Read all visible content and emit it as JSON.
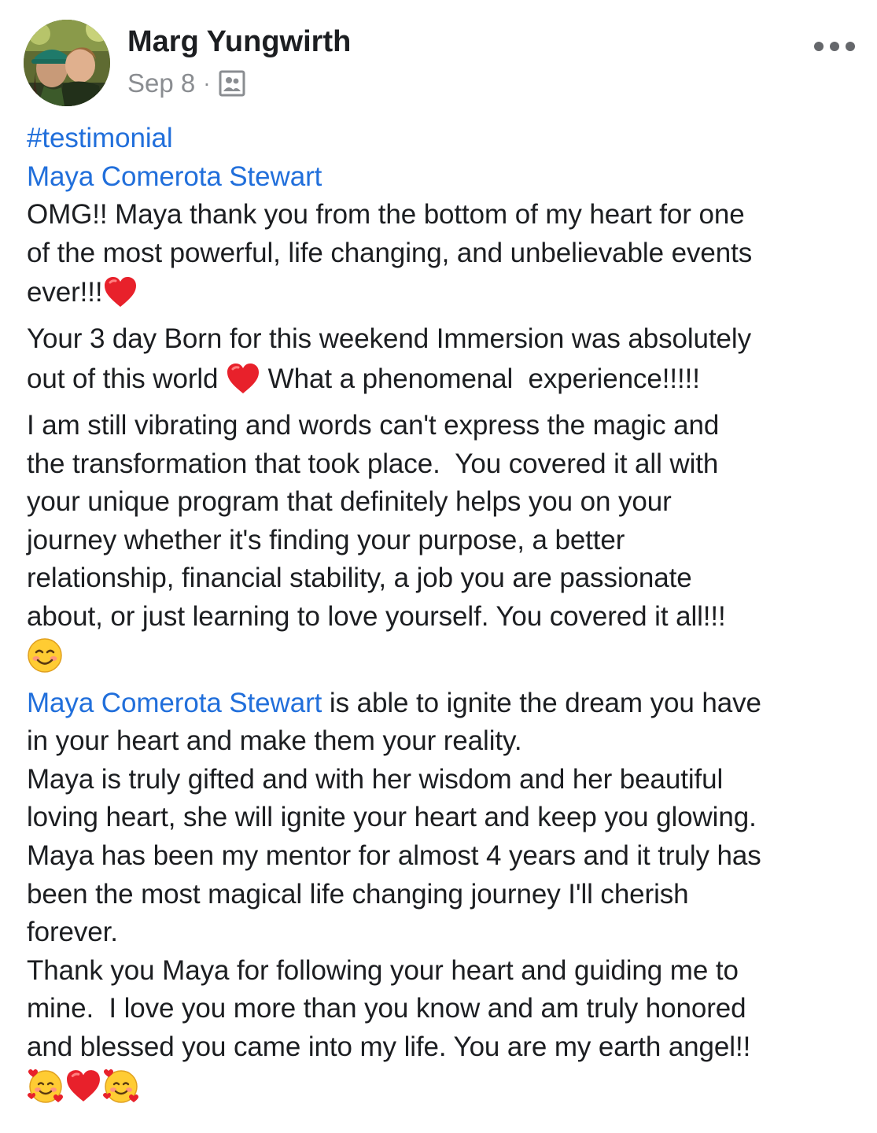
{
  "post": {
    "author": "Marg Yungwirth",
    "date": "Sep 8",
    "separator": "·",
    "audience_icon": "group-audience-icon",
    "more_icon": "more-options-icon",
    "hashtag": "#testimonial",
    "mention": "Maya Comerota Stewart",
    "lines": {
      "l1": "OMG!! Maya thank you from the bottom of my heart for one",
      "l2": "of the most powerful, life changing, and unbelievable events",
      "l3": "ever!!!",
      "l4": "Your 3 day Born for this weekend Immersion was absolutely",
      "l5a": "out of this world ",
      "l5b": " What a phenomenal  experience!!!!!",
      "l6": "I am still vibrating and words can't express the magic and",
      "l7": "the transformation that took place.  You covered it all with",
      "l8": "your unique program that definitely helps you on your",
      "l9": "journey whether it's finding your purpose, a better",
      "l10": "relationship, financial stability, a job you are passionate",
      "l11": "about, or just learning to love yourself. You covered it all!!!",
      "l13": " is able to ignite the dream you have",
      "l14": "in your heart and make them your reality.",
      "l15": "Maya is truly gifted and with her wisdom and her beautiful",
      "l16": "loving heart, she will ignite your heart and keep you glowing.",
      "l17": "Maya has been my mentor for almost 4 years and it truly has",
      "l18": "been the most magical life changing journey I'll cherish",
      "l19": "forever.",
      "l20": "Thank you Maya for following your heart and guiding me to",
      "l21": "mine.  I love you more than you know and am truly honored",
      "l22": "and blessed you came into my life. You are my earth angel!!"
    },
    "emojis": [
      "red-heart-emoji",
      "smiling-face-emoji",
      "smiling-face-with-hearts-emoji"
    ]
  },
  "colors": {
    "link": "#216fdb",
    "text": "#1c1e21",
    "meta": "#8a8d91",
    "heart": "#e8212b"
  }
}
